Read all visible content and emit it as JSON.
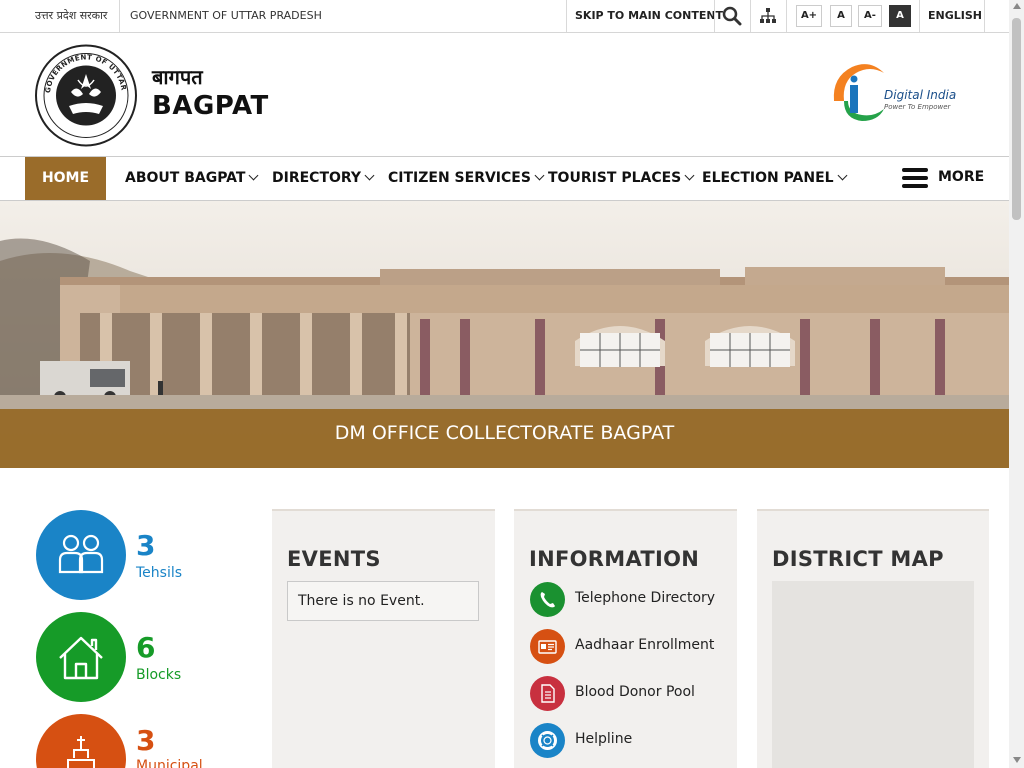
{
  "topbar": {
    "state_hindi": "उत्तर प्रदेश सरकार",
    "state_english": "GOVERNMENT OF UTTAR PRADESH",
    "skip_link": "SKIP TO MAIN CONTENT",
    "font_increase": "A+",
    "font_normal": "A",
    "font_decrease": "A-",
    "contrast": "A",
    "language": "ENGLISH"
  },
  "header": {
    "title_hindi": "बागपत",
    "title_english": "BAGPAT",
    "emblem_text": "GOVERNMENT OF UTTAR PRADESH",
    "digital_india_title": "Digital India",
    "digital_india_tagline": "Power To Empower"
  },
  "nav": {
    "items": [
      {
        "label": "HOME"
      },
      {
        "label": "ABOUT BAGPAT"
      },
      {
        "label": "DIRECTORY"
      },
      {
        "label": "CITIZEN SERVICES"
      },
      {
        "label": "TOURIST PLACES"
      },
      {
        "label": "ELECTION PANEL"
      }
    ],
    "more": "MORE"
  },
  "banner": {
    "caption": "DM OFFICE COLLECTORATE BAGPAT"
  },
  "stats": [
    {
      "number": "3",
      "label": "Tehsils",
      "color": "#1a84c7",
      "icon": "people-icon"
    },
    {
      "number": "6",
      "label": "Blocks",
      "color": "#169b28",
      "icon": "home-icon"
    },
    {
      "number": "3",
      "label": "Municipal",
      "color": "#d65012",
      "icon": "municipal-icon"
    }
  ],
  "events": {
    "heading": "EVENTS",
    "empty_text": "There is no Event."
  },
  "information": {
    "heading": "INFORMATION",
    "items": [
      {
        "label": "Telephone Directory",
        "color": "#1a9130",
        "icon": "phone-icon"
      },
      {
        "label": "Aadhaar Enrollment",
        "color": "#d65012",
        "icon": "id-card-icon"
      },
      {
        "label": "Blood Donor Pool",
        "color": "#c8303f",
        "icon": "document-icon"
      },
      {
        "label": "Helpline",
        "color": "#1a84c7",
        "icon": "lifebuoy-icon"
      }
    ]
  },
  "district_map": {
    "heading": "DISTRICT MAP"
  },
  "colors": {
    "accent_brown": "#9a6c2a",
    "banner_caption_bg": "#91641e"
  }
}
